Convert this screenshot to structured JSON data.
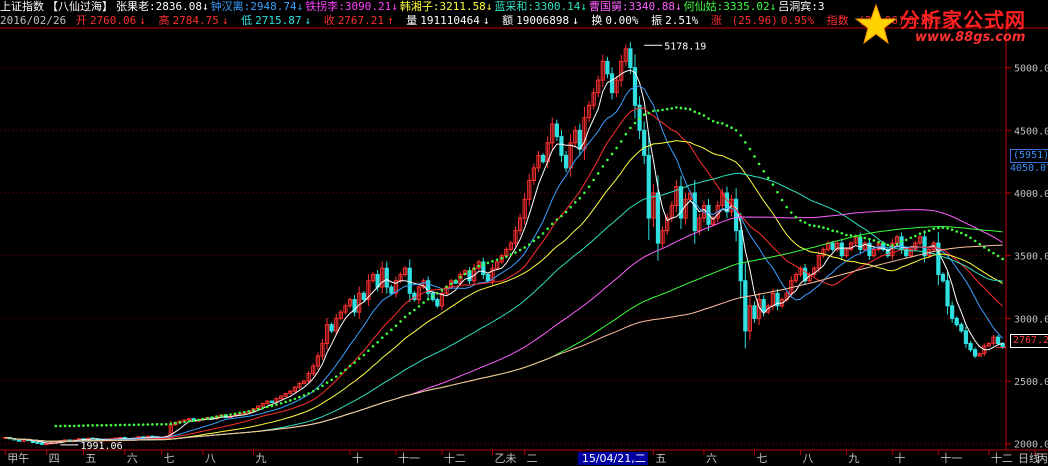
{
  "header": {
    "index_name": "上证指数",
    "formula": "【八仙过海】",
    "indicators": [
      {
        "label": "张果老:",
        "value": "2836.08",
        "arrow": "↓",
        "color": "#ffffff"
      },
      {
        "label": "钟汉离:",
        "value": "2948.74",
        "arrow": "↓",
        "color": "#3aa0ff"
      },
      {
        "label": "铁拐李:",
        "value": "3090.21",
        "arrow": "↓",
        "color": "#ff40ff"
      },
      {
        "label": "韩湘子:",
        "value": "3211.58",
        "arrow": "↓",
        "color": "#ffff40"
      },
      {
        "label": "蓝采和:",
        "value": "3300.14",
        "arrow": "↓",
        "color": "#30e0c0"
      },
      {
        "label": "曹国舅:",
        "value": "3340.88",
        "arrow": "↓",
        "color": "#ff60ff"
      },
      {
        "label": "何仙姑:",
        "value": "3335.02",
        "arrow": "↓",
        "color": "#40ff40"
      },
      {
        "label": "吕洞宾:",
        "value": "3",
        "arrow": "",
        "color": "#ffffff"
      }
    ]
  },
  "quote": {
    "date": "2016/02/26",
    "open_label": "开",
    "open": "2760.06",
    "open_arrow": "↓",
    "high_label": "高",
    "high": "2784.75",
    "high_arrow": "↓",
    "low_label": "低",
    "low": "2715.87",
    "low_arrow": "↓",
    "close_label": "收",
    "close": "2767.21",
    "close_arrow": "↑",
    "volume_label": "量",
    "volume": "191110464",
    "volume_arrow": "↓",
    "amount_label": "额",
    "amount": "19006898",
    "amount_arrow": "↓",
    "turnover_label": "换",
    "turnover": "0.00%",
    "amplitude_label": "振",
    "amplitude": "2.51%",
    "change_label": "涨",
    "change": "(25.96)",
    "change_pct": "0.95%",
    "index_change_label": "指数",
    "index_change": "(25.96)",
    "index_change_pct": "0.95%"
  },
  "right_panel": {
    "box1": "(5951)",
    "box2": "4050.07",
    "price_tag": "2767.2"
  },
  "logo": {
    "name": "分析家公式网",
    "url": "www.88gs.com"
  },
  "colors": {
    "up": "#ff3030",
    "down": "#30e0e0",
    "axis": "#c00000",
    "grid": "#800000",
    "text": "#c0c0c0"
  },
  "chart_data": {
    "type": "candlestick",
    "title": "",
    "xlabel": "",
    "ylabel": "",
    "ylim": [
      1950,
      5300
    ],
    "y_ticks": [
      2000,
      2500,
      3000,
      3500,
      4000,
      4500,
      5000
    ],
    "y_tick_labels": [
      "2000.00",
      "2500.00",
      "3000.00",
      "3500.00",
      "4000.00",
      "4500.00",
      "5000.00"
    ],
    "x_labels": [
      "甲午",
      "四",
      "五",
      "六",
      "七",
      "八",
      "九",
      "十",
      "十一",
      "十二",
      "乙未",
      "二",
      "15/04/21,二",
      "五",
      "六",
      "七",
      "八",
      "九",
      "十",
      "十一",
      "十二",
      "丙申"
    ],
    "x_label_pos": [
      0,
      9,
      17,
      26,
      34,
      43,
      54,
      75,
      85,
      95,
      106,
      113,
      125,
      141,
      152,
      163,
      173,
      183,
      193,
      203,
      214,
      224
    ],
    "period_label": "日线",
    "annotations": [
      {
        "text": "5178.19",
        "x": 139,
        "y": 5178.19
      },
      {
        "text": "1991.06",
        "x": 12,
        "y": 1991.06
      }
    ],
    "ohlc_close": [
      2050,
      2040,
      2030,
      2020,
      2035,
      2025,
      2010,
      2005,
      1995,
      2000,
      2010,
      2015,
      2025,
      2030,
      2020,
      2030,
      2040,
      2035,
      2045,
      2040,
      2030,
      2025,
      2035,
      2040,
      2045,
      2050,
      2040,
      2035,
      2045,
      2055,
      2050,
      2060,
      2055,
      2050,
      2045,
      2060,
      2150,
      2170,
      2180,
      2190,
      2200,
      2180,
      2190,
      2200,
      2210,
      2200,
      2220,
      2230,
      2210,
      2220,
      2230,
      2240,
      2250,
      2260,
      2280,
      2300,
      2320,
      2340,
      2330,
      2360,
      2380,
      2400,
      2420,
      2450,
      2480,
      2500,
      2560,
      2620,
      2700,
      2800,
      2950,
      2900,
      3000,
      3050,
      3100,
      3150,
      3050,
      3200,
      3150,
      3300,
      3350,
      3250,
      3400,
      3250,
      3200,
      3300,
      3350,
      3400,
      3200,
      3150,
      3250,
      3300,
      3200,
      3150,
      3100,
      3200,
      3250,
      3300,
      3280,
      3350,
      3380,
      3300,
      3400,
      3450,
      3350,
      3300,
      3400,
      3450,
      3500,
      3550,
      3600,
      3700,
      3800,
      3950,
      4100,
      4200,
      4300,
      4250,
      4400,
      4550,
      4450,
      4300,
      4200,
      4400,
      4500,
      4350,
      4600,
      4700,
      4800,
      4900,
      5050,
      4950,
      4800,
      4900,
      5050,
      5150,
      5000,
      4700,
      4500,
      4300,
      3800,
      4000,
      3600,
      3700,
      3800,
      3900,
      4050,
      3800,
      3950,
      4000,
      3700,
      3800,
      3900,
      3750,
      3800,
      3900,
      4000,
      3850,
      3950,
      3700,
      3300,
      2900,
      3100,
      3000,
      3150,
      3050,
      3100,
      3200,
      3100,
      3150,
      3200,
      3300,
      3350,
      3400,
      3300,
      3350,
      3400,
      3500,
      3550,
      3600,
      3550,
      3600,
      3500,
      3550,
      3600,
      3650,
      3550,
      3600,
      3500,
      3550,
      3600,
      3550,
      3500,
      3600,
      3650,
      3550,
      3500,
      3550,
      3600,
      3650,
      3500,
      3550,
      3600,
      3350,
      3300,
      3100,
      3000,
      2950,
      2900,
      2800,
      2750,
      2700,
      2720,
      2780,
      2800,
      2850,
      2800,
      2767
    ],
    "ma_series": [
      {
        "color": "#ffffff",
        "period": 5
      },
      {
        "color": "#3aa0ff",
        "period": 13
      },
      {
        "color": "#ff3030",
        "period": 21
      },
      {
        "color": "#ffff40",
        "period": 34
      },
      {
        "color": "#30e0c0",
        "period": 55
      },
      {
        "color": "#ff60ff",
        "period": 89
      },
      {
        "color": "#40ff40",
        "period": 120
      },
      {
        "color": "#ffc0a0",
        "period": 150
      }
    ],
    "dotted_series_color": "#40ff40"
  }
}
